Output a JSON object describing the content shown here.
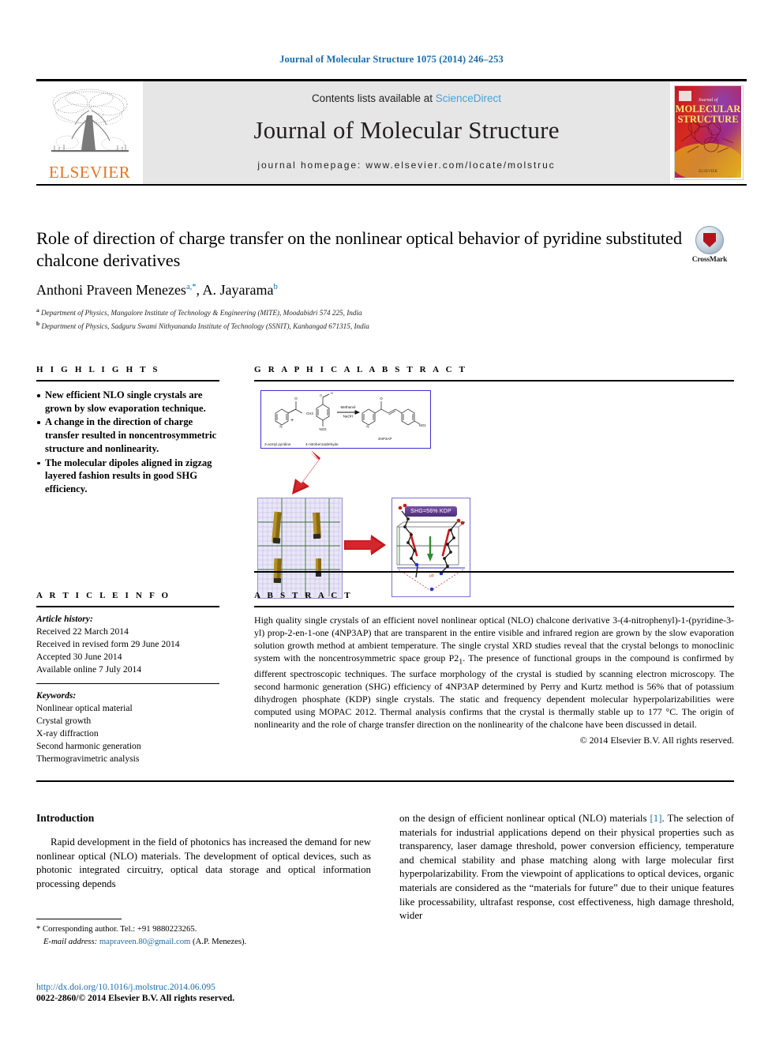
{
  "running_head": "Journal of Molecular Structure 1075 (2014) 246–253",
  "masthead": {
    "contents_prefix": "Contents lists available at ",
    "sciencedirect": "ScienceDirect",
    "journal_name": "Journal of Molecular Structure",
    "homepage": "journal homepage: www.elsevier.com/locate/molstruc",
    "publisher": "ELSEVIER",
    "cover_title_small": "Journal of",
    "cover_title_line1": "MOLECULAR",
    "cover_title_line2": "STRUCTURE"
  },
  "article": {
    "title": "Role of direction of charge transfer on the nonlinear optical behavior of pyridine substituted chalcone derivatives",
    "authors_plain": "Anthoni Praveen Menezes",
    "author1_sup": "a,*",
    "author2_plain": ", A. Jayarama",
    "author2_sup": "b",
    "affiliation_a": "Department of Physics, Mangalore Institute of Technology & Engineering (MITE), Moodabidri 574 225, India",
    "affiliation_b": "Department of Physics, Sadguru Swami Nithyananda Institute of Technology (SSNIT), Kanhangad 671315, India",
    "crossmark_label": "CrossMark"
  },
  "highlights": {
    "heading": "H I G H L I G H T S",
    "items": [
      "New efficient NLO single crystals are grown by slow evaporation technique.",
      "A change in the direction of charge transfer resulted in noncentrosymmetric structure and nonlinearity.",
      "The molecular dipoles aligned in zigzag layered fashion results in good SHG efficiency."
    ]
  },
  "graphical_abstract": {
    "heading": "G R A P H I C A L   A B S T R A C T",
    "scheme": {
      "reagent_left": "3-acetyl pyridine",
      "reagent_right": "4-nitrobenzaldehyde",
      "condition_line1": "Methanol",
      "condition_line2": "NaOH",
      "product": "4NP3AP",
      "label_ch3": "CH3",
      "label_no2_left": "NO2",
      "label_no2_right": "NO2"
    },
    "shg_badge": "SHG=56% KDP",
    "dipole_label": "µD"
  },
  "article_info": {
    "heading": "A R T I C L E   I N F O",
    "history_label": "Article history:",
    "history": [
      "Received 22 March 2014",
      "Received in revised form 29 June 2014",
      "Accepted 30 June 2014",
      "Available online 7 July 2014"
    ],
    "keywords_label": "Keywords:",
    "keywords": [
      "Nonlinear optical material",
      "Crystal growth",
      "X-ray diffraction",
      "Second harmonic generation",
      "Thermogravimetric analysis"
    ]
  },
  "abstract": {
    "heading": "A B S T R A C T",
    "part1": "High quality single crystals of an efficient novel nonlinear optical (NLO) chalcone derivative 3-(4-nitrophenyl)-1-(pyridine-3-yl) prop-2-en-1-one (4NP3AP) that are transparent in the entire visible and infrared region are grown by the slow evaporation solution growth method at ambient temperature. The single crystal XRD studies reveal that the crystal belongs to monoclinic system with the noncentrosymmetric space group P2",
    "subscript1": "1",
    "part2": ". The presence of functional groups in the compound is confirmed by different spectroscopic techniques. The surface morphology of the crystal is studied by scanning electron microscopy. The second harmonic generation (SHG) efficiency of 4NP3AP determined by Perry and Kurtz method is 56% that of potassium dihydrogen phosphate (KDP) single crystals. The static and frequency dependent molecular hyperpolarizabilities were computed using MOPAC 2012. Thermal analysis confirms that the crystal is thermally stable up to 177 °C. The origin of nonlinearity and the role of charge transfer direction on the nonlinearity of the chalcone have been discussed in detail.",
    "copyright": "© 2014 Elsevier B.V. All rights reserved."
  },
  "body": {
    "section_heading": "Introduction",
    "left_paragraph": "Rapid development in the field of photonics has increased the demand for new nonlinear optical (NLO) materials. The development of optical devices, such as photonic integrated circuitry, optical data storage and optical information processing depends",
    "right_paragraph_pre": "on the design of efficient nonlinear optical (NLO) materials ",
    "right_ref": "[1]",
    "right_paragraph_post": ". The selection of materials for industrial applications depend on their physical properties such as transparency, laser damage threshold, power conversion efficiency, temperature and chemical stability and phase matching along with large molecular first hyperpolarizability. From the viewpoint of applications to optical devices, organic materials are considered as the “materials for future” due to their unique features like processability, ultrafast response, cost effectiveness, high damage threshold, wider"
  },
  "footnote": {
    "corresponding": "* Corresponding author. Tel.: +91 9880223265.",
    "email_label": "E-mail address:",
    "email": "mapraveen.80@gmail.com",
    "email_suffix": " (A.P. Menezes)."
  },
  "doi": {
    "url": "http://dx.doi.org/10.1016/j.molstruc.2014.06.095",
    "issn_line": "0022-2860/© 2014 Elsevier B.V. All rights reserved."
  },
  "colors": {
    "link_blue": "#1b6ca8",
    "sciencedirect_blue": "#4a9fd4",
    "elsevier_orange": "#e87422",
    "masthead_grey": "#e6e6e6"
  }
}
